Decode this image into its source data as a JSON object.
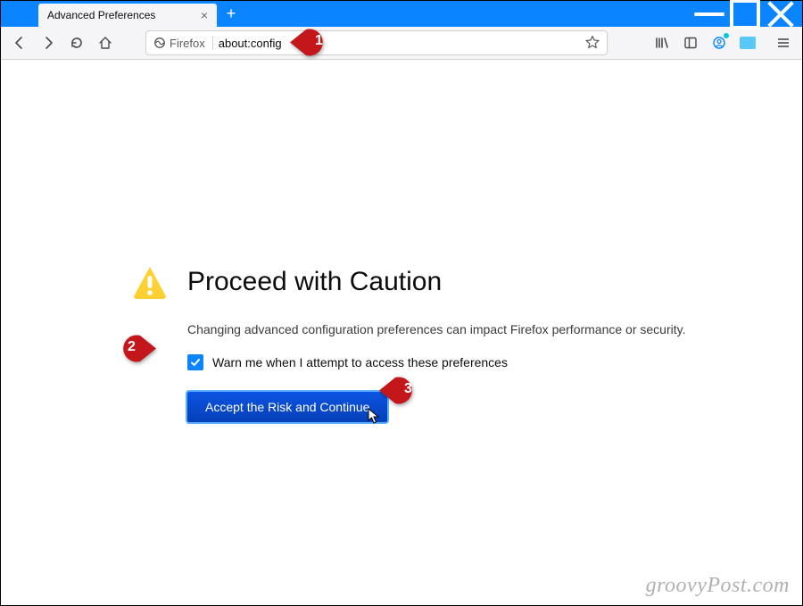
{
  "tab": {
    "title": "Advanced Preferences"
  },
  "urlbar": {
    "identity": "Firefox",
    "url": "about:config"
  },
  "warning": {
    "heading": "Proceed with Caution",
    "description": "Changing advanced configuration preferences can impact Firefox performance or security.",
    "checkbox_label": "Warn me when I attempt to access these preferences",
    "accept_button": "Accept the Risk and Continue"
  },
  "annotations": {
    "b1": "1",
    "b2": "2",
    "b3": "3"
  },
  "watermark": "groovyPost.com"
}
